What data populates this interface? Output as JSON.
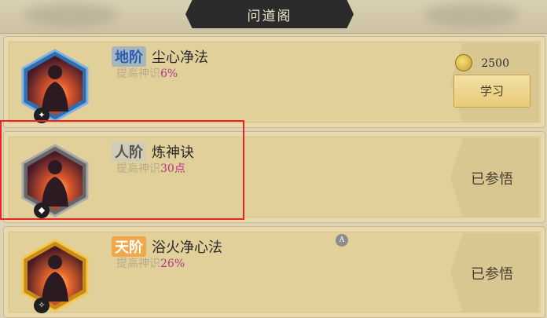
{
  "header": {
    "title": "问道阁"
  },
  "items": [
    {
      "grade": "地阶",
      "name": "尘心净法",
      "desc_prefix": "提高神识",
      "desc_value": "6%",
      "badge_icon": "wind-glyph",
      "cost": "2500",
      "action_label": "学习"
    },
    {
      "grade": "人阶",
      "name": "炼神诀",
      "desc_prefix": "提高神识",
      "desc_value": "30点",
      "badge_icon": "flame-glyph",
      "status": "已参悟"
    },
    {
      "grade": "天阶",
      "name": "浴火净心法",
      "desc_prefix": "提高神识",
      "desc_value": "26%",
      "badge_icon": "fire-glyph",
      "status": "已参悟"
    }
  ],
  "controller_hint": "A",
  "colors": {
    "earth": "#2d5db8",
    "human": "#777777",
    "heaven": "#f0a23c",
    "value": "#b2338a",
    "highlight": "#e22222"
  }
}
